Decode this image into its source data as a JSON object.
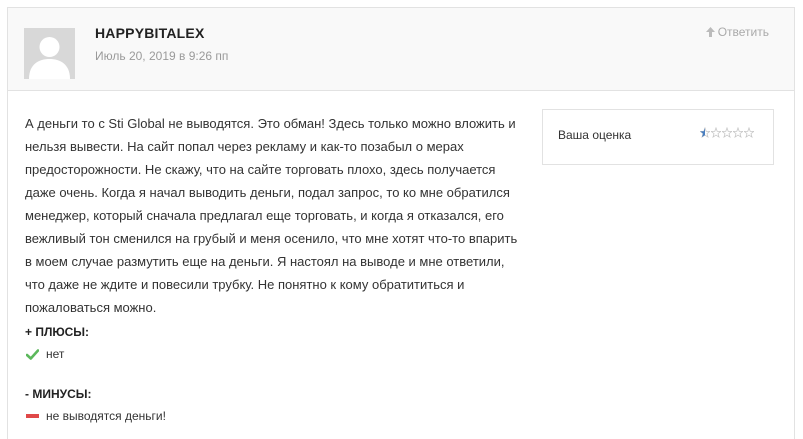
{
  "review": {
    "author": "HAPPYBITALEX",
    "date": "Июль 20, 2019 в 9:26 пп",
    "reply_label": "Ответить",
    "text": "А деньги то с Sti Global не выводятся. Это обман! Здесь только можно вложить и нельзя вывести. На сайт попал через рекламу и как-то позабыл о мерах предосторожности. Не скажу, что на сайте торговать плохо, здесь получается даже очень. Когда я начал выводить деньги, подал запрос, то ко мне обратился менеджер, который сначала предлагал еще торговать, и когда я отказался, его вежливый тон сменился на грубый и меня осенило, что мне хотят что-то впарить в моем случае размутить еще на деньги. Я настоял на выводе и мне ответили, что даже не ждите и повесили трубку. Не понятно к кому обратититься и пожаловаться можно."
  },
  "rating": {
    "label": "Ваша оценка",
    "value": 0.5,
    "max": 5,
    "star_color": "#4a7fc1",
    "empty_star_color": "#c8c8c8"
  },
  "pros": {
    "title": "+ ПЛЮСЫ:",
    "items": [
      "нет"
    ],
    "icon": "check-icon",
    "color": "#5cb85c"
  },
  "cons": {
    "title": "- МИНУСЫ:",
    "items": [
      "не выводятся деньги!"
    ],
    "icon": "minus-icon",
    "color": "#e04848"
  }
}
